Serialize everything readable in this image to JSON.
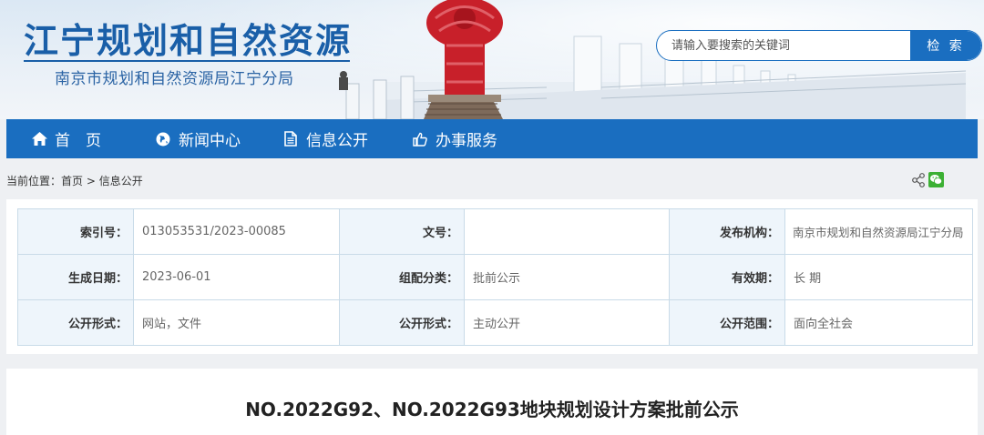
{
  "header": {
    "site_title": "江宁规划和自然资源",
    "site_subtitle": "南京市规划和自然资源局江宁分局",
    "search": {
      "placeholder": "请输入要搜索的关键词",
      "button_label": "检 索"
    }
  },
  "nav": {
    "items": [
      {
        "label": "首　页",
        "icon": "home-icon"
      },
      {
        "label": "新闻中心",
        "icon": "globe-icon"
      },
      {
        "label": "信息公开",
        "icon": "document-icon"
      },
      {
        "label": "办事服务",
        "icon": "thumbs-up-icon"
      }
    ]
  },
  "breadcrumb": {
    "prefix": "当前位置：",
    "home": "首页",
    "separator": " > ",
    "current": "信息公开"
  },
  "meta": {
    "rows": [
      [
        {
          "label": "索引号：",
          "value": "013053531/2023-00085"
        },
        {
          "label": "文号：",
          "value": ""
        },
        {
          "label": "发布机构：",
          "value": "南京市规划和自然资源局江宁分局"
        }
      ],
      [
        {
          "label": "生成日期：",
          "value": "2023-06-01"
        },
        {
          "label": "组配分类：",
          "value": "批前公示"
        },
        {
          "label": "有效期：",
          "value": "长 期"
        }
      ],
      [
        {
          "label": "公开形式：",
          "value": "网站，文件"
        },
        {
          "label": "公开形式：",
          "value": "主动公开"
        },
        {
          "label": "公开范围：",
          "value": "面向全社会"
        }
      ]
    ]
  },
  "article": {
    "title": "NO.2022G92、NO.2022G93地块规划设计方案批前公示"
  },
  "colors": {
    "primary": "#1a6ec0",
    "title_blue": "#1a5fa8",
    "monument_red": "#c8202a",
    "wechat_green": "#3cb034"
  }
}
